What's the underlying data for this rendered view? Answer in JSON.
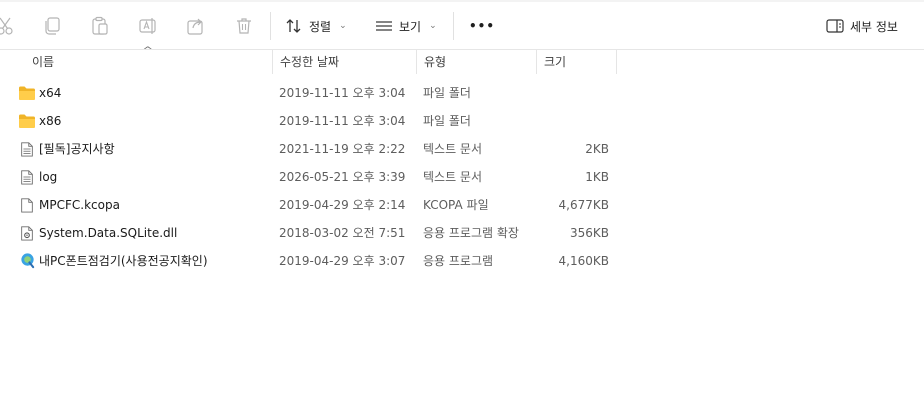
{
  "toolbar": {
    "sort_label": "정렬",
    "view_label": "보기",
    "more_label": "•••",
    "details_label": "세부 정보"
  },
  "columns": {
    "name": "이름",
    "modified": "수정한 날짜",
    "type": "유형",
    "size": "크기"
  },
  "files": [
    {
      "name": "x64",
      "modified": "2019-11-11 오후 3:04",
      "type": "파일 폴더",
      "size": "",
      "icon": "folder-icon"
    },
    {
      "name": "x86",
      "modified": "2019-11-11 오후 3:04",
      "type": "파일 폴더",
      "size": "",
      "icon": "folder-icon"
    },
    {
      "name": "[필독]공지사항",
      "modified": "2021-11-19 오후 2:22",
      "type": "텍스트 문서",
      "size": "2KB",
      "icon": "text-document-icon"
    },
    {
      "name": "log",
      "modified": "2026-05-21 오후 3:39",
      "type": "텍스트 문서",
      "size": "1KB",
      "icon": "text-document-icon"
    },
    {
      "name": "MPCFC.kcopa",
      "modified": "2019-04-29 오후 2:14",
      "type": "KCOPA 파일",
      "size": "4,677KB",
      "icon": "file-icon"
    },
    {
      "name": "System.Data.SQLite.dll",
      "modified": "2018-03-02 오전 7:51",
      "type": "응용 프로그램 확장",
      "size": "356KB",
      "icon": "dll-icon"
    },
    {
      "name": "내PC폰트점검기(사용전공지확인)",
      "modified": "2019-04-29 오후 3:07",
      "type": "응용 프로그램",
      "size": "4,160KB",
      "icon": "app-icon"
    }
  ]
}
